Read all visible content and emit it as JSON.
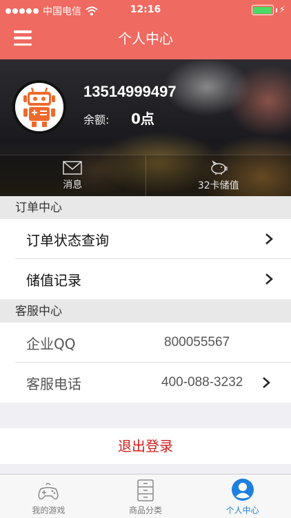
{
  "status_bar": {
    "carrier": "中国电信",
    "time": "12:16"
  },
  "nav": {
    "title": "个人中心"
  },
  "profile": {
    "phone": "13514999497",
    "balance_label": "余额:",
    "balance_value": "0点",
    "tabs": [
      {
        "label": "消息",
        "icon": "envelope-icon"
      },
      {
        "label": "32卡储值",
        "icon": "piggy-bank-icon"
      }
    ]
  },
  "order_section": {
    "header": "订单中心",
    "rows": [
      {
        "label": "订单状态查询"
      },
      {
        "label": "储值记录"
      }
    ]
  },
  "service_section": {
    "header": "客服中心",
    "rows": [
      {
        "label": "企业QQ",
        "value": "800055567"
      },
      {
        "label": "客服电话",
        "value": "400-088-3232"
      }
    ]
  },
  "logout_label": "退出登录",
  "tabbar": {
    "items": [
      {
        "label": "我的游戏",
        "icon": "gamepad-icon"
      },
      {
        "label": "商品分类",
        "icon": "cabinet-icon"
      },
      {
        "label": "个人中心",
        "icon": "user-icon",
        "active": true
      }
    ]
  },
  "colors": {
    "header": "#ef6a61",
    "logout": "#d21d1d",
    "active_tab": "#1e7fde",
    "battery": "#4cd964"
  }
}
